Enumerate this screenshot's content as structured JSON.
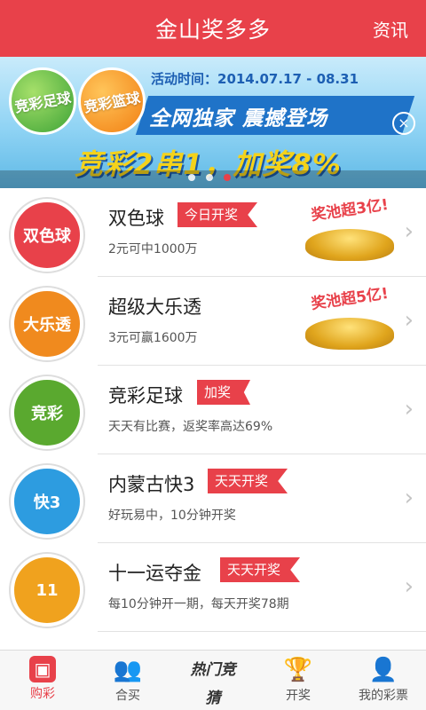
{
  "header": {
    "title": "金山奖多多",
    "news_label": "资讯"
  },
  "banner": {
    "ball1": "竞彩足球",
    "ball2": "竞彩篮球",
    "period": "活动时间：2014.07.17 - 08.31",
    "slogan": "全网独家  震撼登场",
    "promo": "竞彩2串1，加奖8%",
    "close_icon": "×",
    "dots": 3,
    "active_dot": 3
  },
  "items": [
    {
      "name": "双色球",
      "tag": "今日开奖",
      "desc": "2元可中1000万",
      "jackpot": "奖池超3亿!",
      "logo_text": "双色球",
      "logo_color": "#e8414a"
    },
    {
      "name": "超级大乐透",
      "tag": "",
      "desc": "3元可赢1600万",
      "jackpot": "奖池超5亿!",
      "logo_text": "大乐透",
      "logo_color": "#f08a1e"
    },
    {
      "name": "竞彩足球",
      "tag": "加奖",
      "desc": "天天有比赛，返奖率高达69%",
      "jackpot": "",
      "logo_text": "竞彩",
      "logo_color": "#5aa92f"
    },
    {
      "name": "内蒙古快3",
      "tag": "天天开奖",
      "desc": "好玩易中，10分钟开奖",
      "jackpot": "",
      "logo_text": "快3",
      "logo_color": "#2d9ce0"
    },
    {
      "name": "十一运夺金",
      "tag": "天天开奖",
      "desc": "每10分钟开一期，每天开奖78期",
      "jackpot": "",
      "logo_text": "11",
      "logo_color": "#f0a21e"
    }
  ],
  "tabs": [
    {
      "label": "购彩",
      "icon": "shopping-bag-icon",
      "glyph": "▣",
      "active": true
    },
    {
      "label": "合买",
      "icon": "group-icon",
      "glyph": "👥",
      "active": false
    },
    {
      "label": "热门竞猜",
      "icon": "football-icon",
      "glyph": "热门竞猜",
      "active": false
    },
    {
      "label": "开奖",
      "icon": "trophy-icon",
      "glyph": "🏆",
      "active": false
    },
    {
      "label": "我的彩票",
      "icon": "user-icon",
      "glyph": "👤",
      "active": false
    }
  ],
  "colors": {
    "brand": "#e8414a"
  }
}
